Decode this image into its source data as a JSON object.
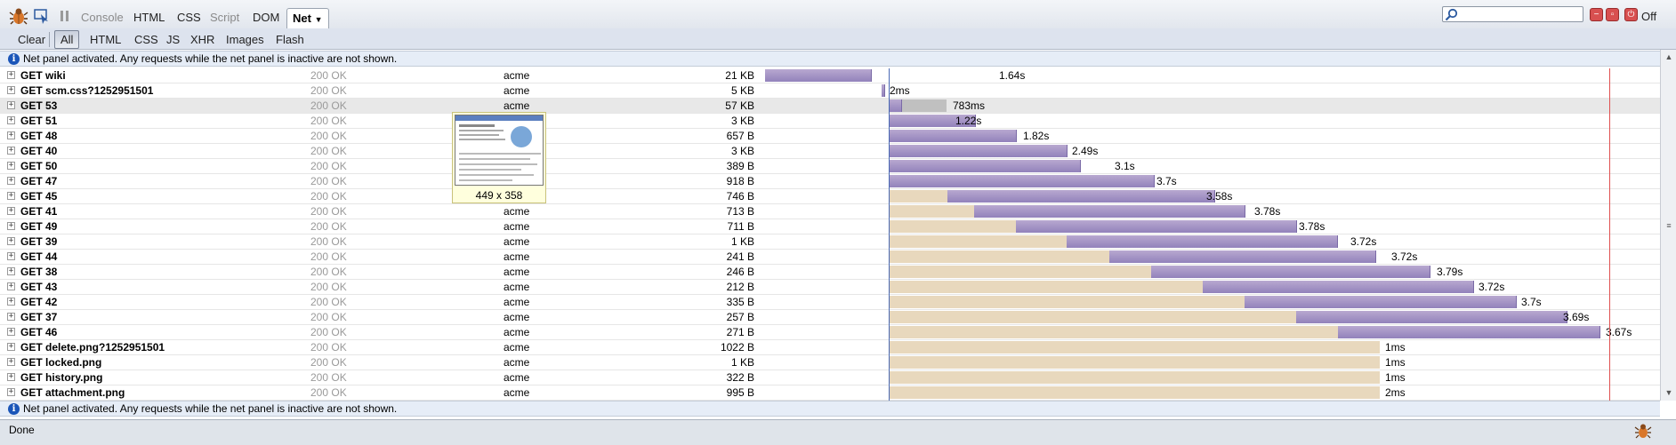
{
  "toolbar": {
    "tabs": [
      "Console",
      "HTML",
      "CSS",
      "Script",
      "DOM"
    ],
    "active_tab": "Net",
    "search_value": "",
    "off_label": "Off"
  },
  "filters": {
    "clear_label": "Clear",
    "items": [
      "All",
      "HTML",
      "CSS",
      "JS",
      "XHR",
      "Images",
      "Flash"
    ]
  },
  "info_message": "Net panel activated. Any requests while the net panel is inactive are not shown.",
  "requests": [
    {
      "url": "GET wiki",
      "status": "200 OK",
      "domain": "acme",
      "size": "21 KB",
      "time": "1.64s"
    },
    {
      "url": "GET scm.css?1252951501",
      "status": "200 OK",
      "domain": "acme",
      "size": "5 KB",
      "time": "2ms"
    },
    {
      "url": "GET 53",
      "status": "200 OK",
      "domain": "acme",
      "size": "57 KB",
      "time": "783ms"
    },
    {
      "url": "GET 51",
      "status": "200 OK",
      "domain": "",
      "size": "3 KB",
      "time": "1.22s"
    },
    {
      "url": "GET 48",
      "status": "200 OK",
      "domain": "",
      "size": "657 B",
      "time": "1.82s"
    },
    {
      "url": "GET 40",
      "status": "200 OK",
      "domain": "",
      "size": "3 KB",
      "time": "2.49s"
    },
    {
      "url": "GET 50",
      "status": "200 OK",
      "domain": "",
      "size": "389 B",
      "time": "3.1s"
    },
    {
      "url": "GET 47",
      "status": "200 OK",
      "domain": "",
      "size": "918 B",
      "time": "3.7s"
    },
    {
      "url": "GET 45",
      "status": "200 OK",
      "domain": "",
      "size": "746 B",
      "time": "3.58s"
    },
    {
      "url": "GET 41",
      "status": "200 OK",
      "domain": "acme",
      "size": "713 B",
      "time": "3.78s"
    },
    {
      "url": "GET 49",
      "status": "200 OK",
      "domain": "acme",
      "size": "711 B",
      "time": "3.78s"
    },
    {
      "url": "GET 39",
      "status": "200 OK",
      "domain": "acme",
      "size": "1 KB",
      "time": "3.72s"
    },
    {
      "url": "GET 44",
      "status": "200 OK",
      "domain": "acme",
      "size": "241 B",
      "time": "3.72s"
    },
    {
      "url": "GET 38",
      "status": "200 OK",
      "domain": "acme",
      "size": "246 B",
      "time": "3.79s"
    },
    {
      "url": "GET 43",
      "status": "200 OK",
      "domain": "acme",
      "size": "212 B",
      "time": "3.72s"
    },
    {
      "url": "GET 42",
      "status": "200 OK",
      "domain": "acme",
      "size": "335 B",
      "time": "3.7s"
    },
    {
      "url": "GET 37",
      "status": "200 OK",
      "domain": "acme",
      "size": "257 B",
      "time": "3.69s"
    },
    {
      "url": "GET 46",
      "status": "200 OK",
      "domain": "acme",
      "size": "271 B",
      "time": "3.67s"
    },
    {
      "url": "GET delete.png?1252951501",
      "status": "200 OK",
      "domain": "acme",
      "size": "1022 B",
      "time": "1ms"
    },
    {
      "url": "GET locked.png",
      "status": "200 OK",
      "domain": "acme",
      "size": "1 KB",
      "time": "1ms"
    },
    {
      "url": "GET history.png",
      "status": "200 OK",
      "domain": "acme",
      "size": "322 B",
      "time": "1ms"
    },
    {
      "url": "GET attachment.png",
      "status": "200 OK",
      "domain": "acme",
      "size": "995 B",
      "time": "2ms"
    }
  ],
  "tooltip": {
    "label": "449 x 358"
  },
  "statusbar": {
    "text": "Done"
  },
  "colors": {
    "waiting": "#e8d8bd",
    "receiving": "#9282bb",
    "load_line": "#e05050",
    "dom_line": "#4a6ab5"
  }
}
